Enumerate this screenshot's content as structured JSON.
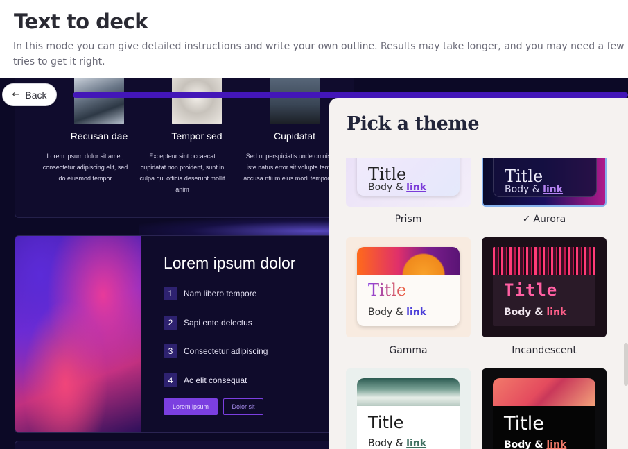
{
  "header": {
    "title": "Text to deck",
    "description": "In this mode you can give detailed instructions and write your own outline. Results may take longer, and you may need a few tries to get it right."
  },
  "back_button": {
    "label": "Back",
    "icon": "arrow-left-icon"
  },
  "progress": {
    "fraction": 1.0,
    "color": "#4316b8"
  },
  "preview": {
    "columns": [
      {
        "title": "Recusan dae",
        "text": "Lorem ipsum dolor sit amet, consectetur adipiscing elit, sed do eiusmod tempor"
      },
      {
        "title": "Tempor sed",
        "text": "Excepteur sint occaecat cupidatat non proident, sunt in culpa qui officia deserunt mollit anim"
      },
      {
        "title": "Cupidatat",
        "text": "Sed ut perspiciatis unde omnis iste natus error sit volupta tem accusa ntium eius modi tempora"
      }
    ],
    "main": {
      "title": "Lorem ipsum dolor",
      "items": [
        {
          "num": "1",
          "label": "Nam libero tempore"
        },
        {
          "num": "2",
          "label": "Sapi ente delectus"
        },
        {
          "num": "3",
          "label": "Consectetur adipiscing"
        },
        {
          "num": "4",
          "label": "Ac elit consequat"
        }
      ],
      "primary_button": "Lorem ipsum",
      "secondary_button": "Dolor sit"
    }
  },
  "theme_panel": {
    "title": "Pick a theme",
    "selected": "Aurora",
    "themes": [
      {
        "name": "Prism",
        "title": "Title",
        "body": "Body &",
        "link": "link"
      },
      {
        "name": "Aurora",
        "title": "Title",
        "body": "Body &",
        "link": "link",
        "check": "✓"
      },
      {
        "name": "Gamma",
        "title": "Title",
        "body": "Body &",
        "link": "link"
      },
      {
        "name": "Incandescent",
        "title": "Title",
        "body": "Body &",
        "link": "link"
      },
      {
        "name": "",
        "title": "Title",
        "body": "Body &",
        "link": "link"
      },
      {
        "name": "",
        "title": "Title",
        "body": "Body &",
        "link": "link"
      }
    ]
  },
  "colors": {
    "preview_bg": "#0c0926",
    "panel_bg": "#f5f2f0",
    "accent": "#7b3fe0",
    "selected_border": "#86b1ec"
  }
}
